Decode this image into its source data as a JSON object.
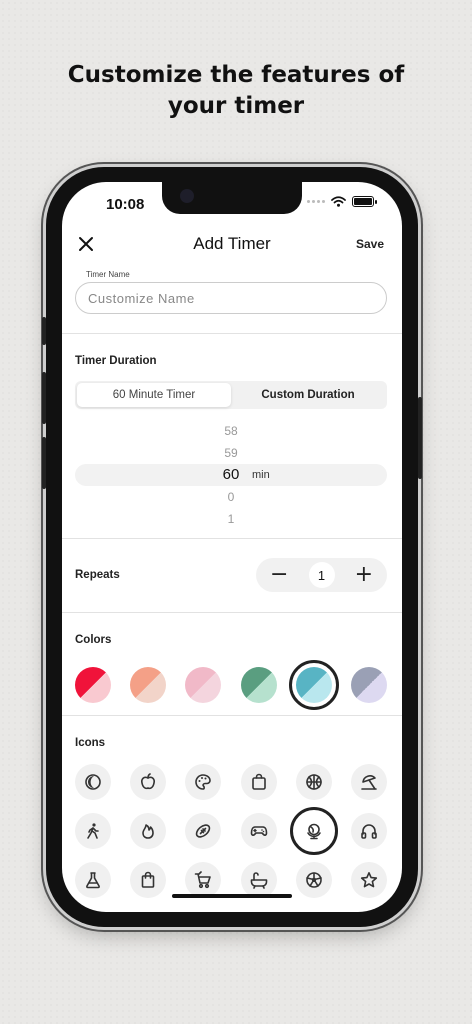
{
  "headline": {
    "line1": "Customize the features of",
    "line2": "your timer"
  },
  "status": {
    "time": "10:08"
  },
  "nav": {
    "title": "Add Timer",
    "save_label": "Save",
    "close_icon": "close-icon"
  },
  "name_field": {
    "label": "Timer Name",
    "placeholder": "Customize Name",
    "value": ""
  },
  "duration": {
    "title": "Timer Duration",
    "tabs": [
      "60 Minute Timer",
      "Custom Duration"
    ],
    "selected_tab": "Custom Duration",
    "picker": {
      "above": [
        "58",
        "59"
      ],
      "selected": "60",
      "unit": "min",
      "below": [
        "0",
        "1"
      ]
    }
  },
  "repeats": {
    "title": "Repeats",
    "minus": "−",
    "value": "1",
    "plus": "+"
  },
  "colors": {
    "title": "Colors",
    "swatches": [
      {
        "a": "#f0133a",
        "b": "#f9c9d0"
      },
      {
        "a": "#f4a087",
        "b": "#f2d4c9"
      },
      {
        "a": "#f1b9c8",
        "b": "#f4d5de"
      },
      {
        "a": "#5a9e80",
        "b": "#b6e1ce"
      },
      {
        "a": "#58b4c4",
        "b": "#b9e7ee"
      },
      {
        "a": "#9aa0b5",
        "b": "#ddd9f1"
      }
    ],
    "selected_index": 4
  },
  "icons": {
    "title": "Icons",
    "items": [
      "moon-icon",
      "apple-icon",
      "palette-icon",
      "shopping-bag-icon",
      "basketball-icon",
      "umbrella-beach-icon",
      "walking-icon",
      "flame-icon",
      "football-icon",
      "gamepad-icon",
      "globe-icon",
      "headphones-icon",
      "flask-icon",
      "bag-icon",
      "cart-icon",
      "bathtub-icon",
      "soccer-ball-icon",
      "star-icon"
    ],
    "selected_index": 10
  }
}
